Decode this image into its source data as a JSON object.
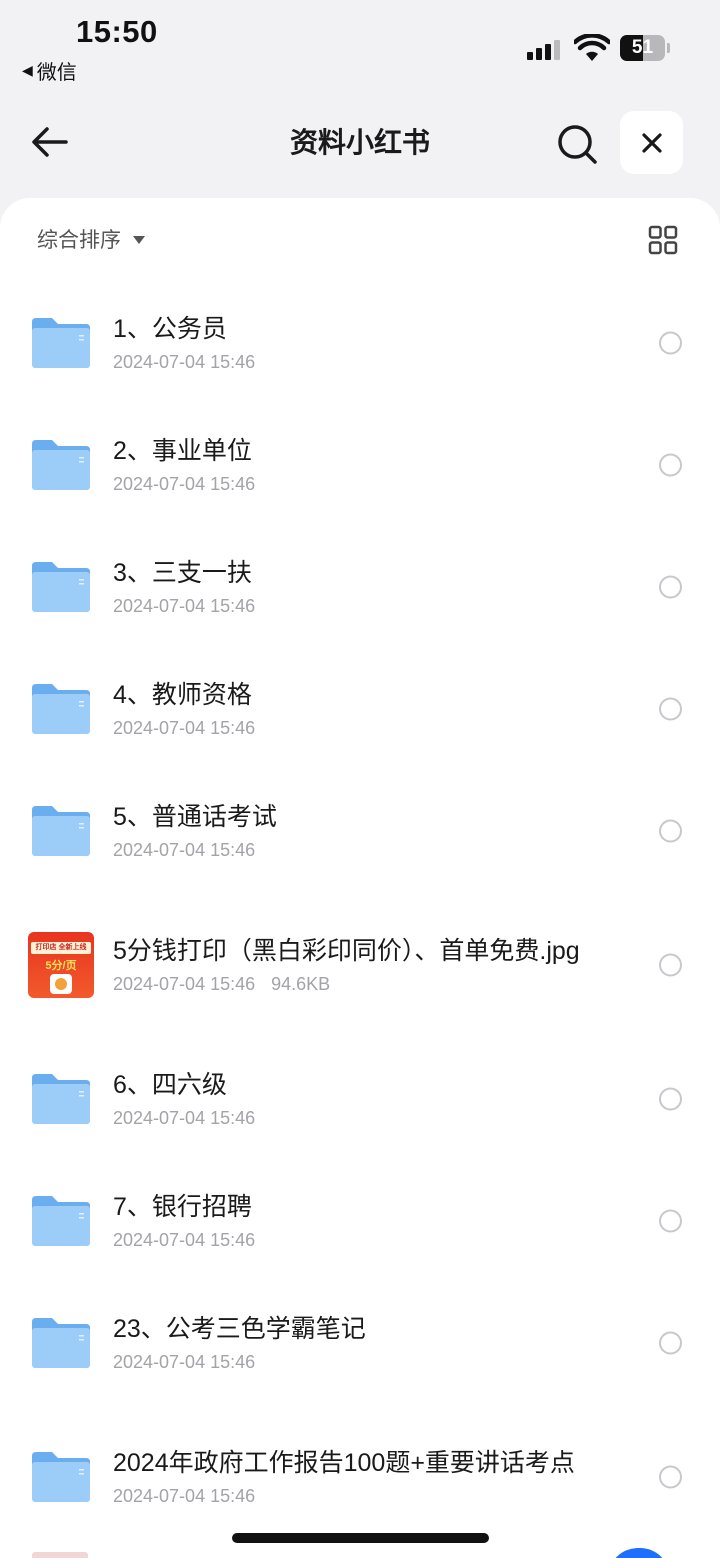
{
  "status_bar": {
    "time": "15:50",
    "back_app": "微信",
    "battery": "51",
    "battery_level": 0.51
  },
  "nav": {
    "title": "资料小红书",
    "back_icon": "arrow-left-icon",
    "search_icon": "search-icon",
    "close_icon": "close-icon"
  },
  "toolbar": {
    "sort_label": "综合排序",
    "view_icon": "grid-view-icon"
  },
  "colors": {
    "folder": "#6aaef0",
    "folder_light": "#9ccdf8",
    "accent": "#1f6fff"
  },
  "files": [
    {
      "name": "1、公务员",
      "date": "2024-07-04 15:46",
      "size": "",
      "type": "folder"
    },
    {
      "name": "2、事业单位",
      "date": "2024-07-04 15:46",
      "size": "",
      "type": "folder"
    },
    {
      "name": "3、三支一扶",
      "date": "2024-07-04 15:46",
      "size": "",
      "type": "folder"
    },
    {
      "name": "4、教师资格",
      "date": "2024-07-04 15:46",
      "size": "",
      "type": "folder"
    },
    {
      "name": "5、普通话考试",
      "date": "2024-07-04 15:46",
      "size": "",
      "type": "folder"
    },
    {
      "name": "5分钱打印（黑白彩印同价）、首单免费.jpg",
      "date": "2024-07-04 15:46",
      "size": "94.6KB",
      "type": "image",
      "thumb": {
        "line1": "打印店 全新上线",
        "line2": "5分/页"
      }
    },
    {
      "name": "6、四六级",
      "date": "2024-07-04 15:46",
      "size": "",
      "type": "folder"
    },
    {
      "name": "7、银行招聘",
      "date": "2024-07-04 15:46",
      "size": "",
      "type": "folder"
    },
    {
      "name": "23、公考三色学霸笔记",
      "date": "2024-07-04 15:46",
      "size": "",
      "type": "folder"
    },
    {
      "name": "2024年政府工作报告100题+重要讲话考点",
      "date": "2024-07-04 15:46",
      "size": "",
      "type": "folder"
    }
  ]
}
